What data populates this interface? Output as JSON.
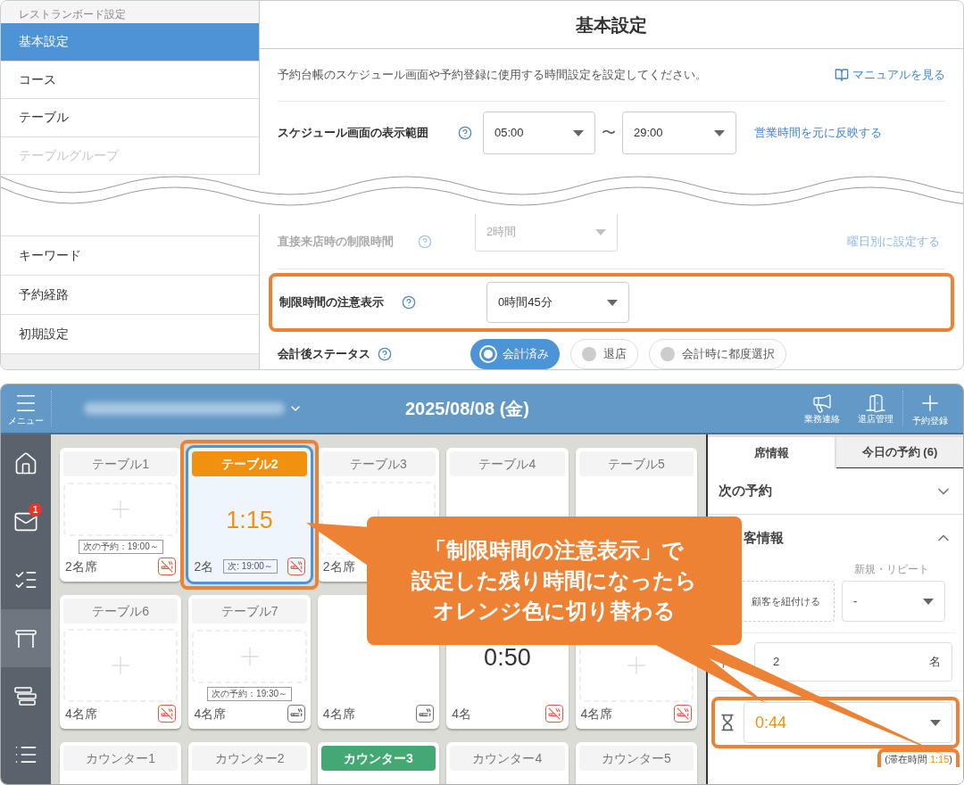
{
  "settings": {
    "sidebar": {
      "heading": "レストランボード設定",
      "items_before": [
        {
          "label": "基本設定",
          "selected": true
        },
        {
          "label": "コース",
          "selected": false
        },
        {
          "label": "テーブル",
          "selected": false
        },
        {
          "label": "テーブルグループ",
          "selected": false
        }
      ],
      "items_after": [
        {
          "label": "キーワード",
          "selected": false
        },
        {
          "label": "予約経路",
          "selected": false
        },
        {
          "label": "初期設定",
          "selected": false
        }
      ]
    },
    "title": "基本設定",
    "description": "予約台帳のスケジュール画面や予約登録に使用する時間設定を設定してください。",
    "manual_link": "マニュアルを見る",
    "display_range": {
      "label": "スケジュール画面の表示範囲",
      "from": "05:00",
      "separator": "〜",
      "to": "29:00",
      "link": "営業時間を元に反映する"
    },
    "walk_in_limit": {
      "label": "直接来店時の制限時間",
      "value": "2時間",
      "link": "曜日別に設定する"
    },
    "limit_warning": {
      "label": "制限時間の注意表示",
      "value": "0時間45分",
      "highlighted": true
    },
    "after_checkout": {
      "label": "会計後ステータス",
      "options": [
        {
          "label": "会計済み",
          "selected": true
        },
        {
          "label": "退店",
          "selected": false
        },
        {
          "label": "会計時に都度選択",
          "selected": false
        }
      ]
    }
  },
  "board": {
    "menu_label": "メニュー",
    "date": "2025/08/08 (金)",
    "actions": [
      {
        "kind": "megaphone",
        "label": "業務連絡"
      },
      {
        "kind": "door",
        "label": "退店管理"
      },
      {
        "kind": "plus",
        "label": "予約登録"
      }
    ],
    "rail": [
      {
        "kind": "home",
        "selected": false
      },
      {
        "kind": "mail",
        "badge": "1",
        "selected": false
      },
      {
        "kind": "checklist",
        "selected": false
      },
      {
        "kind": "table",
        "selected": true
      },
      {
        "kind": "layers",
        "selected": false
      },
      {
        "kind": "list",
        "selected": false
      }
    ],
    "cards": [
      {
        "title": "テーブル1",
        "kind": "empty",
        "selected": false,
        "tag": "次の予約：19:00～",
        "seats": "2名席",
        "smoking": false
      },
      {
        "title": "テーブル2",
        "color": "#f0920f",
        "kind": "timer",
        "selected": true,
        "highlighted": true,
        "timer": "1:15",
        "warning": true,
        "tag": "次: 19:00～",
        "seats": "2名",
        "smoking": false
      },
      {
        "title": "テーブル3",
        "kind": "empty",
        "selected": false,
        "seats": "2名席"
      },
      {
        "title": "テーブル4",
        "kind": "covered",
        "selected": false
      },
      {
        "title": "テーブル5",
        "kind": "covered",
        "selected": false
      },
      {
        "title": "テーブル6",
        "kind": "empty",
        "selected": false,
        "seats": "4名席",
        "smoking": false
      },
      {
        "title": "テーブル7",
        "kind": "empty",
        "selected": false,
        "tag": "次の予約：19:30～",
        "seats": "4名席",
        "smoking": true
      },
      {
        "kind": "covered",
        "selected": false,
        "seats": "4名席",
        "smoking": true
      },
      {
        "kind": "timer",
        "selected": false,
        "timer": "0:50",
        "warning": false,
        "seats": "4名",
        "smoking": false
      },
      {
        "kind": "empty",
        "selected": false,
        "seats": "4名席",
        "smoking": false
      },
      {
        "title": "カウンター1",
        "kind": "cut",
        "selected": false
      },
      {
        "title": "カウンター2",
        "kind": "cut",
        "selected": false
      },
      {
        "title": "カウンター3",
        "color": "#43a874",
        "kind": "cut",
        "selected": false
      },
      {
        "title": "カウンター4",
        "kind": "cut",
        "selected": false
      },
      {
        "title": "カウンター5",
        "kind": "cut",
        "selected": false
      }
    ],
    "panel": {
      "tabs": [
        {
          "label": "席情報",
          "selected": true
        },
        {
          "label": "今日の予約 (6)",
          "selected": false
        }
      ],
      "next_reservation": {
        "label": "次の予約",
        "expanded": false
      },
      "customer": {
        "label": "客情報",
        "expanded": true,
        "type_label": "新規・リピート",
        "link_button": "顧客を紐付ける",
        "type_value": "-"
      },
      "people": {
        "value": "2",
        "unit": "名"
      },
      "remaining": {
        "value": "0:44",
        "warning": true,
        "highlighted": true
      },
      "stay": {
        "open": "(滞在時間",
        "value": "1:15",
        "close": ")"
      }
    },
    "callout": {
      "lines": [
        "「制限時間の注意表示」で",
        "設定した残り時間になったら",
        "オレンジ色に切り替わる"
      ]
    }
  }
}
